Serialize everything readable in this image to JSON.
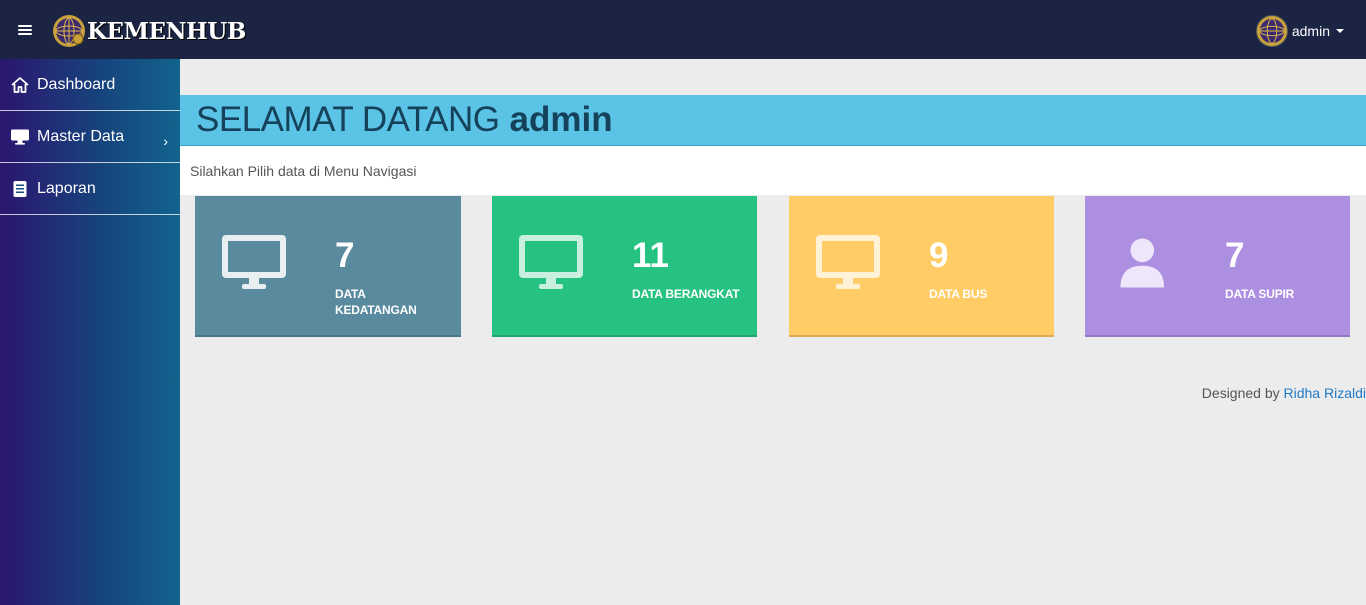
{
  "header": {
    "brand": "KEMENHUB",
    "user": "admin",
    "icons": {
      "menu": "hamburger-icon",
      "logo": "kemenhub-logo",
      "avatar": "user-avatar",
      "dropdown": "caret-down-icon"
    }
  },
  "sidebar": {
    "items": [
      {
        "label": "Dashboard",
        "icon": "home-icon"
      },
      {
        "label": "Master Data",
        "icon": "monitor-icon",
        "has_submenu": true
      },
      {
        "label": "Laporan",
        "icon": "document-icon"
      }
    ]
  },
  "main": {
    "welcome_title": "SELAMAT DATANG",
    "welcome_name": "admin",
    "subtitle": "Silahkan Pilih data di Menu Navigasi",
    "cards": [
      {
        "value": "7",
        "label": "DATA KEDATANGAN",
        "icon": "monitor-icon",
        "color": "#5a8a9e"
      },
      {
        "value": "11",
        "label": "DATA BERANGKAT",
        "icon": "monitor-icon",
        "color": "#26c281"
      },
      {
        "value": "9",
        "label": "DATA BUS",
        "icon": "monitor-icon",
        "color": "#ffcc66"
      },
      {
        "value": "7",
        "label": "DATA SUPIR",
        "icon": "user-icon",
        "color": "#ad8fe1"
      }
    ]
  },
  "footer": {
    "prefix": "Designed by",
    "author": "Ridha Rizaldi"
  }
}
